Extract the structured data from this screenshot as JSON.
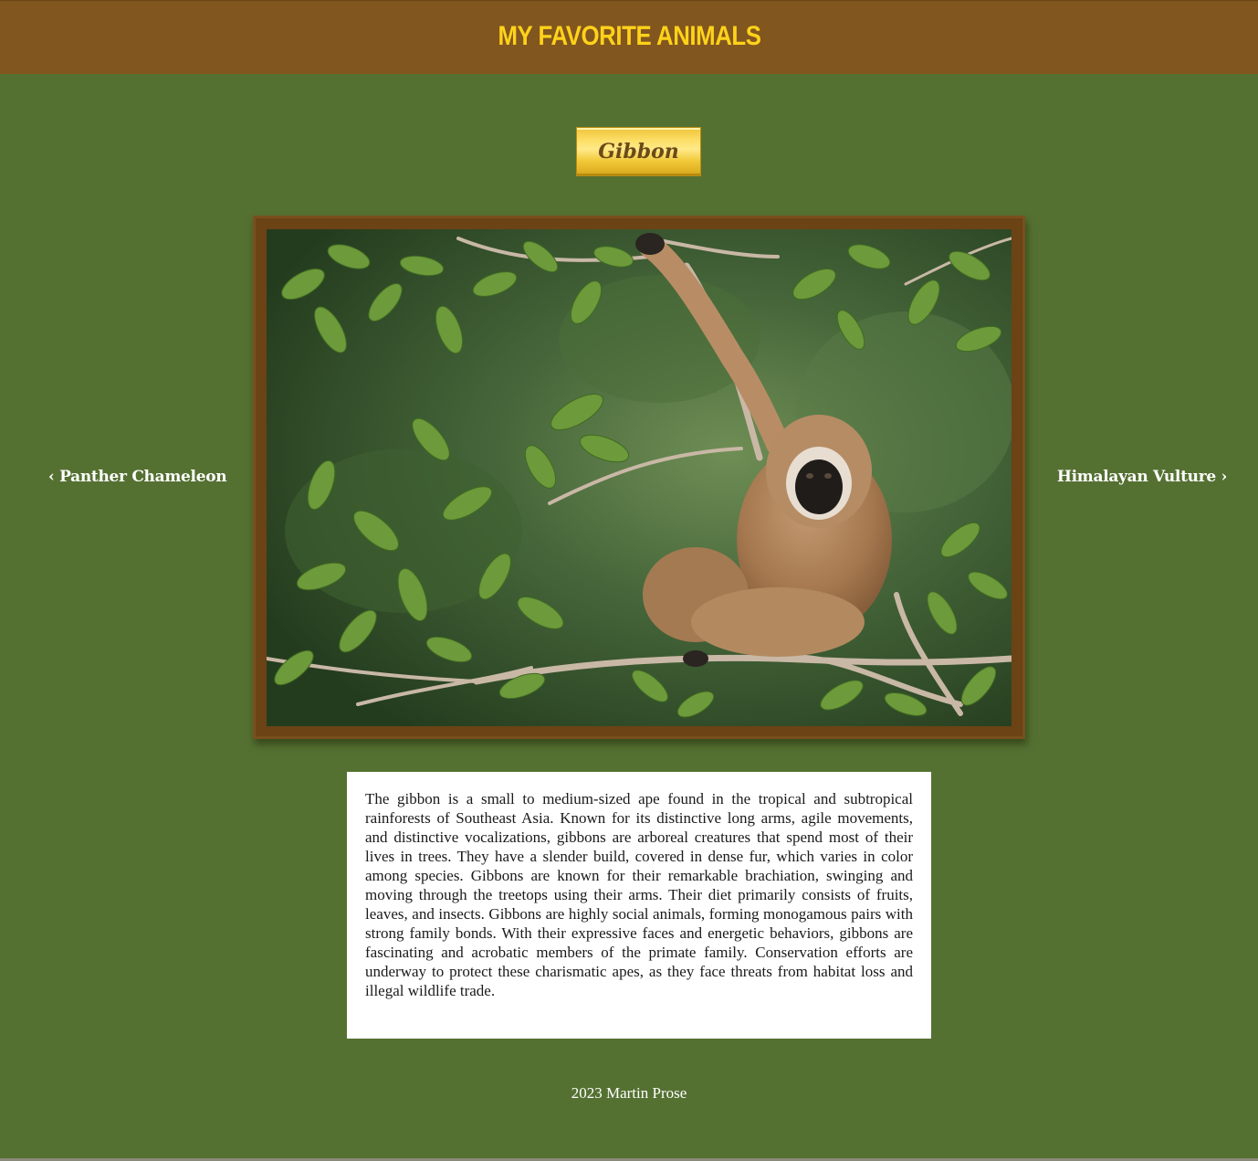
{
  "header": {
    "title": "MY FAVORITE ANIMALS"
  },
  "animal": {
    "name": "Gibbon",
    "description": "The gibbon is a small to medium-sized ape found in the tropical and subtropical rainforests of Southeast Asia. Known for its distinctive long arms, agile movements, and distinctive vocalizations, gibbons are arboreal creatures that spend most of their lives in trees. They have a slender build, covered in dense fur, which varies in color among species. Gibbons are known for their remarkable brachiation, swinging and moving through the treetops using their arms. Their diet primarily consists of fruits, leaves, and insects. Gibbons are highly social animals, forming monogamous pairs with strong family bonds. With their expressive faces and energetic behaviors, gibbons are fascinating and acrobatic members of the primate family. Conservation efforts are underway to protect these charismatic apes, as they face threats from habitat loss and illegal wildlife trade."
  },
  "navigation": {
    "prev_label": "Panther Chameleon",
    "next_label": "Himalayan Vulture",
    "prev_icon": "chevron-left-icon",
    "next_icon": "chevron-right-icon"
  },
  "footer": {
    "text": "2023 Martin Prose"
  },
  "colors": {
    "page_background": "#557132",
    "header_background": "#82561f",
    "title_color": "#ffd21a",
    "frame_color": "#6b4315",
    "plate_gold": "#fde06a"
  }
}
